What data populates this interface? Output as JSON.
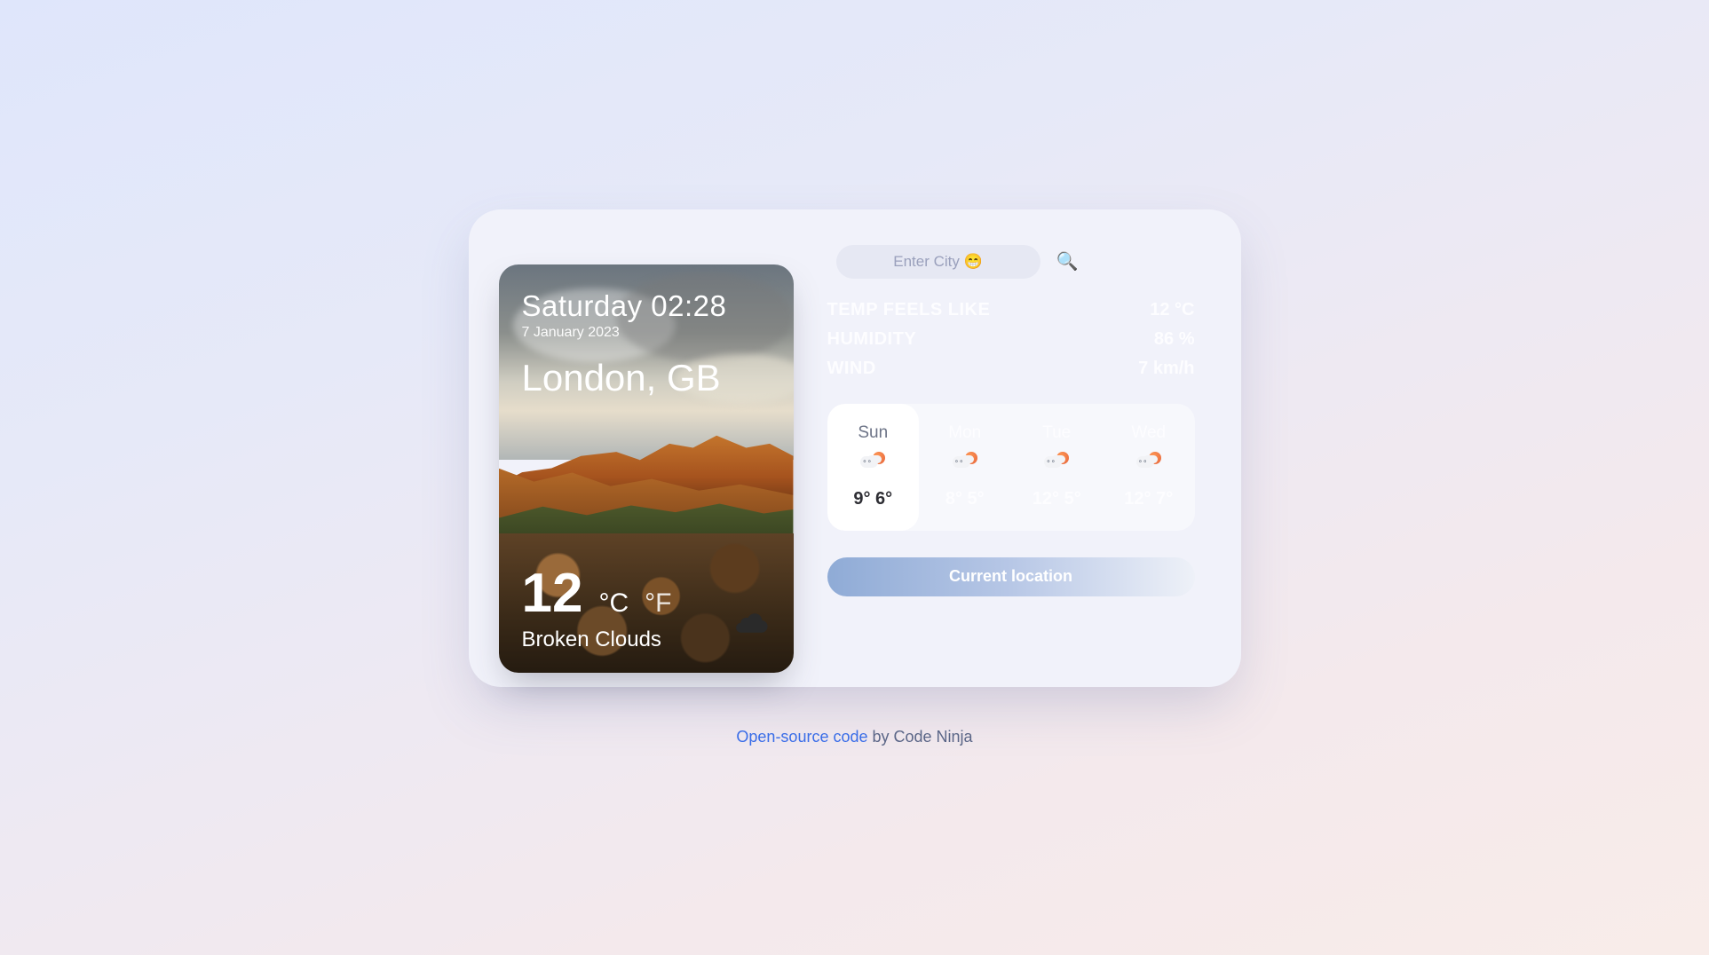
{
  "hero": {
    "day_time": "Saturday 02:28",
    "date": "7 January 2023",
    "city": "London, GB",
    "temperature": "12",
    "unit_c": "°C",
    "unit_f": "°F",
    "description": "Broken Clouds"
  },
  "search": {
    "placeholder": "Enter City 😁",
    "icon": "🔍"
  },
  "stats": {
    "feels_label": "TEMP FEELS LIKE",
    "feels_value": "12 °C",
    "humidity_label": "HUMIDITY",
    "humidity_value": "86 %",
    "wind_label": "WIND",
    "wind_value": "7 km/h"
  },
  "forecast": [
    {
      "day": "Sun",
      "hi": "9°",
      "lo": "6°",
      "active": true
    },
    {
      "day": "Mon",
      "hi": "8°",
      "lo": "5°",
      "active": false
    },
    {
      "day": "Tue",
      "hi": "12°",
      "lo": "5°",
      "active": false
    },
    {
      "day": "Wed",
      "hi": "12°",
      "lo": "7°",
      "active": false
    }
  ],
  "location_button": "Current location",
  "footer": {
    "link_text": "Open-source code",
    "rest": " by Code Ninja"
  }
}
